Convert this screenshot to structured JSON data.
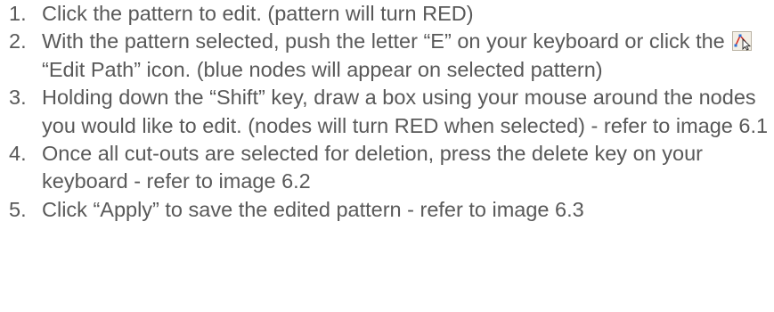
{
  "steps": [
    {
      "number": "1.",
      "text": "Click the pattern to edit. (pattern will turn RED)"
    },
    {
      "number": "2.",
      "text_before_icon": "With the pattern selected, push the letter “E” on your keyboard or click the ",
      "icon": "edit-path-icon",
      "text_after_icon": "“Edit Path” icon. (blue nodes will appear on selected pattern)"
    },
    {
      "number": "3.",
      "text": "Holding down the “Shift” key, draw a box using your mouse around the nodes you would like to edit. (nodes will turn RED when selected) - refer to image 6.1"
    },
    {
      "number": "4.",
      "text": "Once all cut-outs are selected for deletion, press the delete key on your keyboard - refer to image 6.2"
    },
    {
      "number": "5.",
      "text": "Click “Apply” to save the edited pattern - refer to image 6.3"
    }
  ],
  "colors": {
    "text": "#595959",
    "icon_red": "#d9342b",
    "icon_blue": "#2a6fd6"
  }
}
